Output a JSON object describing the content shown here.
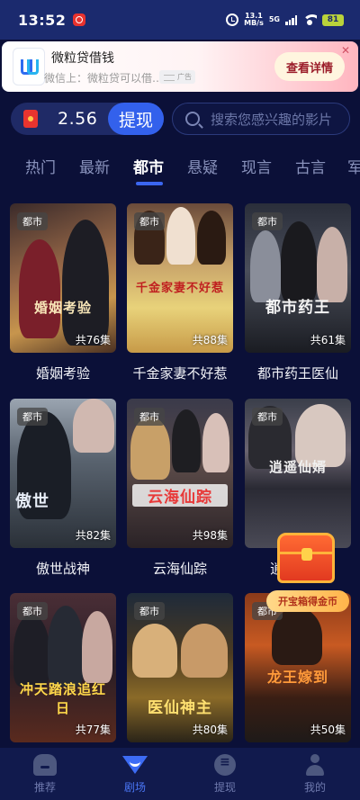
{
  "status_bar": {
    "time": "13:52",
    "speed_value": "13.1",
    "speed_unit": "MB/s",
    "network": "5G",
    "battery": "81"
  },
  "ad": {
    "title": "微粒贷借钱",
    "subtitle": "微信上：微粒贷可以借…",
    "tag": "广告",
    "cta": "查看详情",
    "close": "✕"
  },
  "wallet": {
    "amount": "2.56",
    "withdraw_label": "提现"
  },
  "search": {
    "placeholder": "搜索您感兴趣的影片"
  },
  "tabs": [
    {
      "label": "热门",
      "active": false
    },
    {
      "label": "最新",
      "active": false
    },
    {
      "label": "都市",
      "active": true
    },
    {
      "label": "悬疑",
      "active": false
    },
    {
      "label": "现言",
      "active": false
    },
    {
      "label": "古言",
      "active": false
    },
    {
      "label": "军",
      "active": false
    }
  ],
  "dramas": [
    {
      "badge": "都市",
      "title": "婚姻考验",
      "poster_text": "婚姻考验",
      "episodes": "共76集"
    },
    {
      "badge": "都市",
      "title": "千金家妻不好惹",
      "poster_text": "千金家妻不好惹",
      "episodes": "共88集"
    },
    {
      "badge": "都市",
      "title": "都市药王医仙",
      "poster_text": "都市药王",
      "episodes": "共61集"
    },
    {
      "badge": "都市",
      "title": "傲世战神",
      "poster_text": "傲世",
      "episodes": "共82集"
    },
    {
      "badge": "都市",
      "title": "云海仙踪",
      "poster_text": "云海仙踪",
      "episodes": "共98集"
    },
    {
      "badge": "都市",
      "title": "逍遥仙婿",
      "poster_text": "逍遥仙婿",
      "episodes": ""
    },
    {
      "badge": "都市",
      "title": "",
      "poster_text": "冲天踏浪追红日",
      "episodes": "共77集"
    },
    {
      "badge": "都市",
      "title": "",
      "poster_text": "医仙神主",
      "episodes": "共80集"
    },
    {
      "badge": "都市",
      "title": "",
      "poster_text": "龙王嫁到",
      "episodes": "共50集"
    }
  ],
  "chest": {
    "label": "开宝箱得金币"
  },
  "bottom_nav": [
    {
      "label": "推荐",
      "icon": "home-icon",
      "active": false
    },
    {
      "label": "剧场",
      "icon": "theater-icon",
      "active": true
    },
    {
      "label": "提现",
      "icon": "chat-icon",
      "active": false
    },
    {
      "label": "我的",
      "icon": "user-icon",
      "active": false
    }
  ],
  "colors": {
    "background": "#0b1038",
    "accent": "#3b66f0",
    "status_bar": "#1b2a6e"
  }
}
